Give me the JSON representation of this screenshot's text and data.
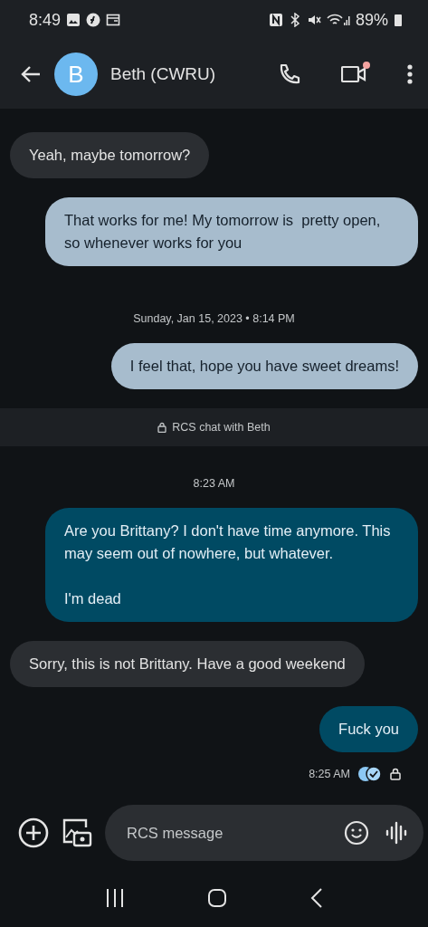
{
  "status_bar": {
    "time": "8:49",
    "battery": "89%"
  },
  "header": {
    "avatar_letter": "B",
    "contact": "Beth (CWRU)",
    "video_badge": true
  },
  "thread": [
    {
      "kind": "in",
      "text": "Yeah, maybe tomorrow?"
    },
    {
      "kind": "sms_out",
      "text": "That works for me! My tomorrow is  pretty open, so whenever works for you"
    },
    {
      "kind": "date",
      "text": "Sunday, Jan 15, 2023 • 8:14 PM"
    },
    {
      "kind": "sms_out",
      "text": "I feel that, hope you have sweet dreams!"
    },
    {
      "kind": "banner",
      "text": "RCS chat with Beth"
    },
    {
      "kind": "date",
      "text": "8:23 AM"
    },
    {
      "kind": "rcs_out",
      "text": "Are you Brittany? I don't have time anymore. This may seem out of nowhere, but whatever.\n\nI'm dead"
    },
    {
      "kind": "in",
      "text": "Sorry, this is not Brittany. Have a good weekend"
    },
    {
      "kind": "rcs_out",
      "text": "Fuck you"
    },
    {
      "kind": "receipt",
      "text": "8:25 AM",
      "read": true
    }
  ],
  "composer": {
    "placeholder": "RCS message"
  }
}
